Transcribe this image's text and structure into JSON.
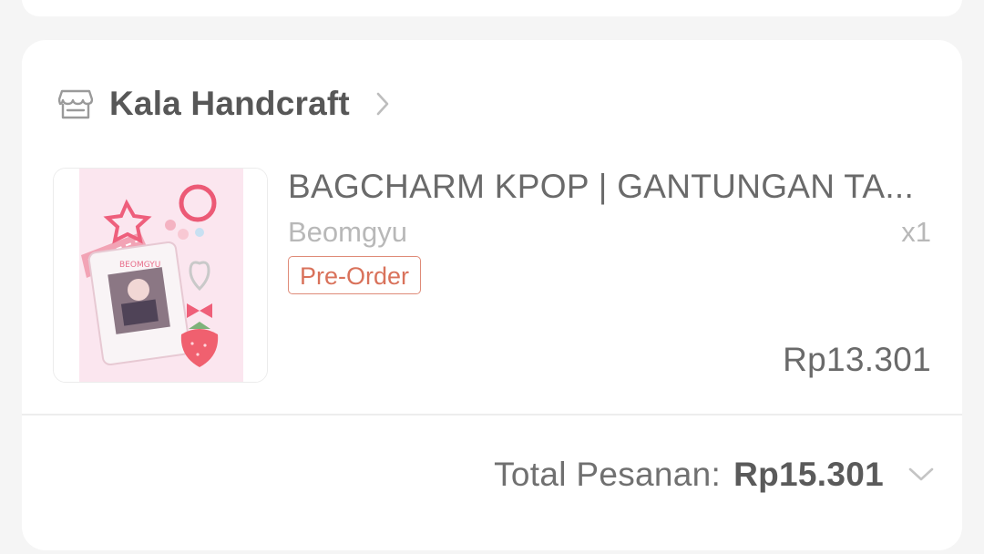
{
  "shop": {
    "name": "Kala Handcraft",
    "icon": "store-icon",
    "chevron_icon": "chevron-right-icon"
  },
  "product": {
    "title": "BAGCHARM KPOP | GANTUNGAN TA...",
    "variant": "Beomgyu",
    "quantity": "x1",
    "badge": "Pre-Order",
    "price": "Rp13.301",
    "image": "keychain-photo"
  },
  "order_total": {
    "label": "Total Pesanan:",
    "value": "Rp15.301",
    "chevron_icon": "chevron-down-icon"
  },
  "colors": {
    "accent": "#d9725b",
    "badge_border": "#df8b78"
  }
}
